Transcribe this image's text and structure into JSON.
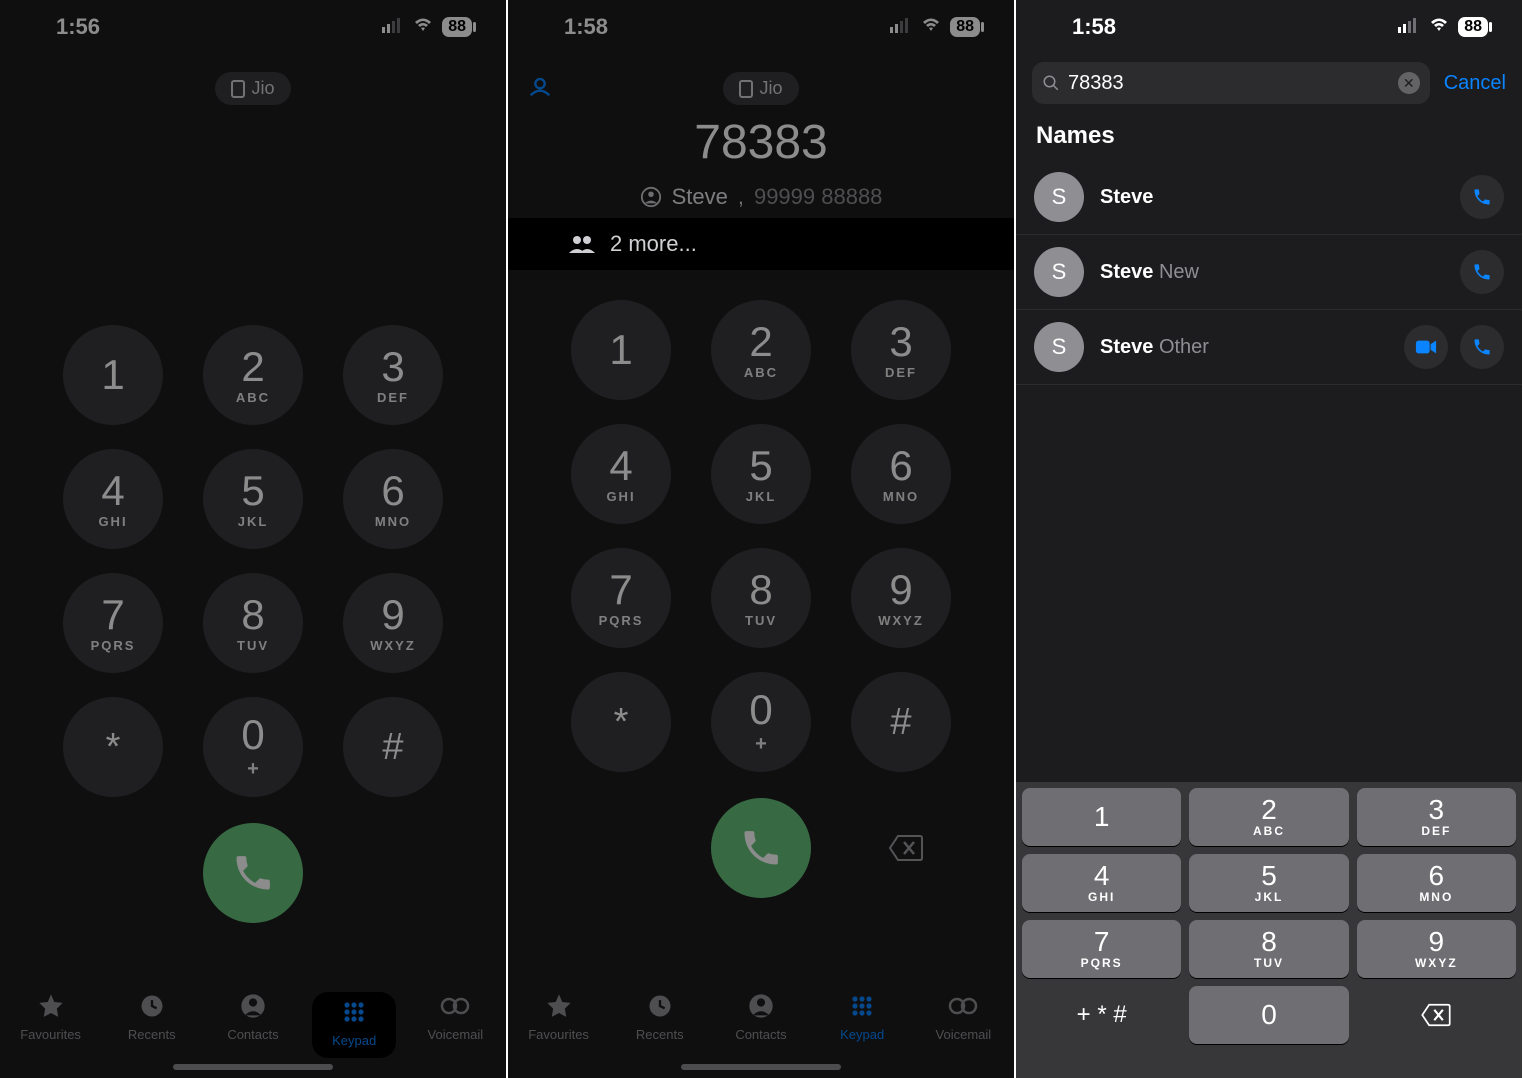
{
  "status": {
    "time1": "1:56",
    "time2": "1:58",
    "time3": "1:58",
    "battery": "88"
  },
  "carrier": "Jio",
  "panel2": {
    "typed": "78383",
    "match_name": "Steve",
    "match_number": "99999 88888",
    "more": "2 more..."
  },
  "keypad": [
    {
      "num": "1",
      "sub": ""
    },
    {
      "num": "2",
      "sub": "ABC"
    },
    {
      "num": "3",
      "sub": "DEF"
    },
    {
      "num": "4",
      "sub": "GHI"
    },
    {
      "num": "5",
      "sub": "JKL"
    },
    {
      "num": "6",
      "sub": "MNO"
    },
    {
      "num": "7",
      "sub": "PQRS"
    },
    {
      "num": "8",
      "sub": "TUV"
    },
    {
      "num": "9",
      "sub": "WXYZ"
    },
    {
      "num": "*",
      "sub": ""
    },
    {
      "num": "0",
      "sub": "+"
    },
    {
      "num": "#",
      "sub": ""
    }
  ],
  "tabs": [
    {
      "label": "Favourites"
    },
    {
      "label": "Recents"
    },
    {
      "label": "Contacts"
    },
    {
      "label": "Keypad"
    },
    {
      "label": "Voicemail"
    }
  ],
  "panel3": {
    "search": "78383",
    "cancel": "Cancel",
    "section": "Names",
    "contacts": [
      {
        "initial": "S",
        "primary": "Steve",
        "secondary": "",
        "video": false
      },
      {
        "initial": "S",
        "primary": "Steve",
        "secondary": "New",
        "video": false
      },
      {
        "initial": "S",
        "primary": "Steve",
        "secondary": "Other",
        "video": true
      }
    ],
    "keyboard": [
      {
        "num": "1",
        "sub": ""
      },
      {
        "num": "2",
        "sub": "ABC"
      },
      {
        "num": "3",
        "sub": "DEF"
      },
      {
        "num": "4",
        "sub": "GHI"
      },
      {
        "num": "5",
        "sub": "JKL"
      },
      {
        "num": "6",
        "sub": "MNO"
      },
      {
        "num": "7",
        "sub": "PQRS"
      },
      {
        "num": "8",
        "sub": "TUV"
      },
      {
        "num": "9",
        "sub": "WXYZ"
      }
    ],
    "symbols": "+ * #",
    "zero": "0"
  }
}
